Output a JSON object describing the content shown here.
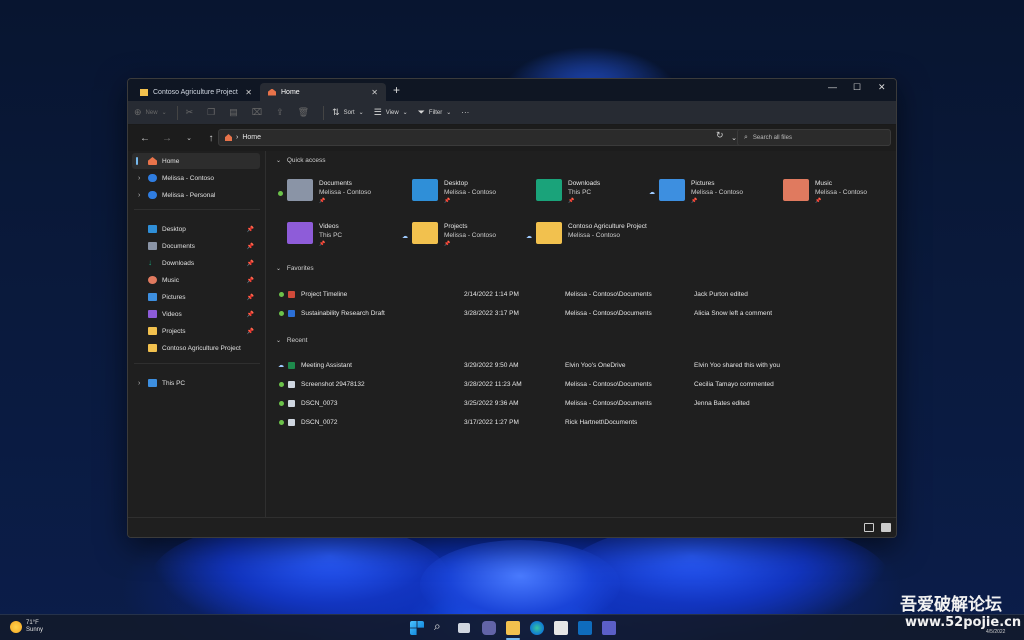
{
  "window": {
    "tabs": [
      {
        "label": "Contoso Agriculture Project"
      },
      {
        "label": "Home"
      }
    ],
    "controls": {
      "minimize": "—",
      "maximize": "☐",
      "close": "✕"
    }
  },
  "toolbar": {
    "new_label": "New",
    "sort_label": "Sort",
    "view_label": "View",
    "filter_label": "Filter",
    "more_label": "···"
  },
  "address": {
    "path": "Home",
    "search_placeholder": "Search all files"
  },
  "sidebar": {
    "items": [
      {
        "label": "Home"
      },
      {
        "label": "Melissa - Contoso"
      },
      {
        "label": "Melissa - Personal"
      },
      {
        "label": "Desktop"
      },
      {
        "label": "Documents"
      },
      {
        "label": "Downloads"
      },
      {
        "label": "Music"
      },
      {
        "label": "Pictures"
      },
      {
        "label": "Videos"
      },
      {
        "label": "Projects"
      },
      {
        "label": "Contoso Agriculture Project"
      },
      {
        "label": "This PC"
      }
    ]
  },
  "quick_access": {
    "title": "Quick access",
    "items": [
      {
        "name": "Documents",
        "location": "Melissa - Contoso",
        "color": "#8a94a6"
      },
      {
        "name": "Desktop",
        "location": "Melissa - Contoso",
        "color": "#2f8fd8"
      },
      {
        "name": "Downloads",
        "location": "This PC",
        "color": "#1aa37a"
      },
      {
        "name": "Pictures",
        "location": "Melissa - Contoso",
        "color": "#3d8fe0"
      },
      {
        "name": "Music",
        "location": "Melissa - Contoso",
        "color": "#e07a5f"
      },
      {
        "name": "Videos",
        "location": "This PC",
        "color": "#8e5cd9"
      },
      {
        "name": "Projects",
        "location": "Melissa - Contoso",
        "color": "#f2c14e"
      },
      {
        "name": "Contoso Agriculture Project",
        "location": "Melissa - Contoso",
        "color": "#f2c14e"
      }
    ]
  },
  "favorites": {
    "title": "Favorites",
    "rows": [
      {
        "name": "Project Timeline",
        "date": "2/14/2022 1:14 PM",
        "location": "Melissa - Contoso\\Documents",
        "activity": "Jack Purton edited"
      },
      {
        "name": "Sustainability Research Draft",
        "date": "3/28/2022 3:17 PM",
        "location": "Melissa - Contoso\\Documents",
        "activity": "Alicia Snow left a comment"
      }
    ]
  },
  "recent": {
    "title": "Recent",
    "rows": [
      {
        "name": "Meeting Assistant",
        "date": "3/29/2022 9:50 AM",
        "location": "Elvin Yoo's OneDrive",
        "activity": "Elvin Yoo shared this with you"
      },
      {
        "name": "Screenshot 29478132",
        "date": "3/28/2022 11:23 AM",
        "location": "Melissa - Contoso\\Documents",
        "activity": "Cecilia Tamayo commented"
      },
      {
        "name": "DSCN_0073",
        "date": "3/25/2022 9:36 AM",
        "location": "Melissa - Contoso\\Documents",
        "activity": "Jenna Bates edited"
      },
      {
        "name": "DSCN_0072",
        "date": "3/17/2022 1:27 PM",
        "location": "Rick Hartnett\\Documents",
        "activity": ""
      }
    ]
  },
  "taskbar": {
    "weather_temp": "71°F",
    "weather_desc": "Sunny",
    "date": "4/5/2022"
  },
  "watermark": {
    "line1": "吾爱破解论坛",
    "line2": "www.52pojie.cn"
  }
}
